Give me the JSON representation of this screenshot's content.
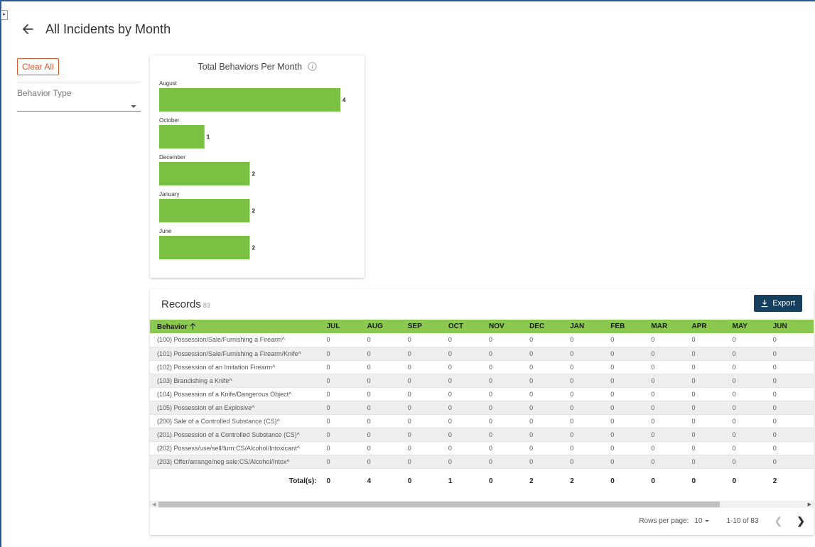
{
  "header": {
    "title": "All Incidents by Month"
  },
  "sidebar": {
    "clear_all_label": "Clear All",
    "filter_label": "Behavior Type"
  },
  "chart": {
    "title": "Total Behaviors Per Month",
    "bar_color": "#7ac143"
  },
  "chart_data": {
    "type": "bar",
    "orientation": "horizontal",
    "title": "Total Behaviors Per Month",
    "categories": [
      "August",
      "October",
      "December",
      "January",
      "June"
    ],
    "values": [
      4,
      1,
      2,
      2,
      2
    ],
    "xlim": [
      0,
      4
    ],
    "grid": false,
    "data_labels": true
  },
  "records": {
    "title": "Records",
    "count": "83",
    "export_label": "Export",
    "columns": [
      "Behavior",
      "JUL",
      "AUG",
      "SEP",
      "OCT",
      "NOV",
      "DEC",
      "JAN",
      "FEB",
      "MAR",
      "APR",
      "MAY",
      "JUN"
    ],
    "rows": [
      [
        "(100) Possession/Sale/Furnishing a Firearm^",
        "0",
        "0",
        "0",
        "0",
        "0",
        "0",
        "0",
        "0",
        "0",
        "0",
        "0",
        "0"
      ],
      [
        "(101) Possession/Sale/Furnishing a Firearm/Knife^",
        "0",
        "0",
        "0",
        "0",
        "0",
        "0",
        "0",
        "0",
        "0",
        "0",
        "0",
        "0"
      ],
      [
        "(102) Possession of an Imitation Firearm^",
        "0",
        "0",
        "0",
        "0",
        "0",
        "0",
        "0",
        "0",
        "0",
        "0",
        "0",
        "0"
      ],
      [
        "(103) Brandishing a Knife^",
        "0",
        "0",
        "0",
        "0",
        "0",
        "0",
        "0",
        "0",
        "0",
        "0",
        "0",
        "0"
      ],
      [
        "(104) Possession of a Knife/Dangerous Object^",
        "0",
        "0",
        "0",
        "0",
        "0",
        "0",
        "0",
        "0",
        "0",
        "0",
        "0",
        "0"
      ],
      [
        "(105) Possession of an Explosive^",
        "0",
        "0",
        "0",
        "0",
        "0",
        "0",
        "0",
        "0",
        "0",
        "0",
        "0",
        "0"
      ],
      [
        "(200) Sale of a Controlled Substance (CS)^",
        "0",
        "0",
        "0",
        "0",
        "0",
        "0",
        "0",
        "0",
        "0",
        "0",
        "0",
        "0"
      ],
      [
        "(201) Possession of a Controlled Substance (CS)^",
        "0",
        "0",
        "0",
        "0",
        "0",
        "0",
        "0",
        "0",
        "0",
        "0",
        "0",
        "0"
      ],
      [
        "(202) Possess/use/sell/furn:CS/Alcohol/Intoxicant^",
        "0",
        "0",
        "0",
        "0",
        "0",
        "0",
        "0",
        "0",
        "0",
        "0",
        "0",
        "0"
      ],
      [
        "(203) Offer/arrange/neg sale:CS/Alcohol/Intox^",
        "0",
        "0",
        "0",
        "0",
        "0",
        "0",
        "0",
        "0",
        "0",
        "0",
        "0",
        "0"
      ]
    ],
    "totals_label": "Total(s):",
    "totals": [
      "0",
      "4",
      "0",
      "1",
      "0",
      "2",
      "2",
      "0",
      "0",
      "0",
      "0",
      "2"
    ]
  },
  "pagination": {
    "rows_per_page_label": "Rows per page:",
    "rows_per_page_value": "10",
    "range": "1-10 of 83"
  },
  "colors": {
    "accent_header": "#8bc850",
    "export_bg": "#153f5d",
    "clear_all": "#e1552b"
  }
}
